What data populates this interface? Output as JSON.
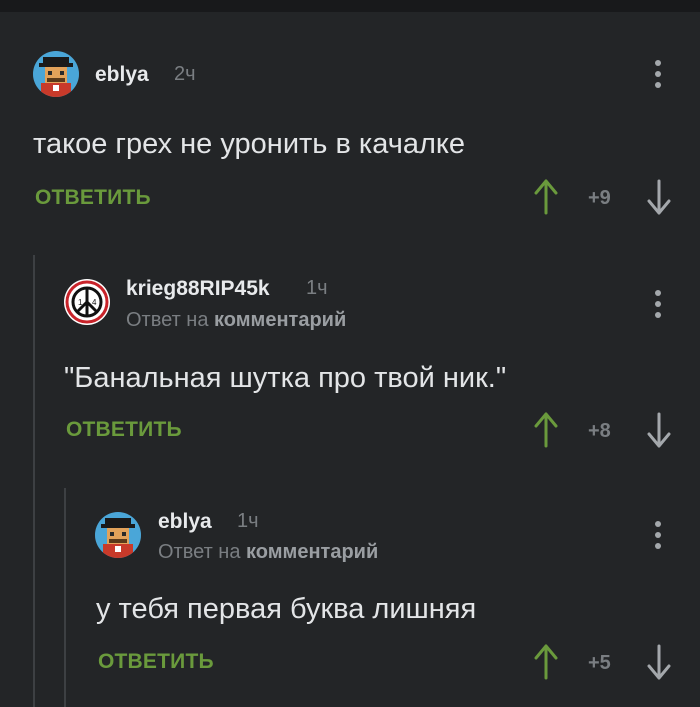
{
  "comments": [
    {
      "username": "eblya",
      "time": "2ч",
      "reply_prefix": "",
      "reply_link": "",
      "text": "такое грех не уронить в качалке",
      "reply_label": "ОТВЕТИТЬ",
      "score": "+9",
      "avatar_icon": "pixel-character-avatar"
    },
    {
      "username": "krieg88RIP45k",
      "time": "1ч",
      "reply_prefix": "Ответ на ",
      "reply_link": "комментарий",
      "text": "\"Банальная шутка про твой ник.\"",
      "reply_label": "ОТВЕТИТЬ",
      "score": "+8",
      "avatar_icon": "peace-sign-avatar"
    },
    {
      "username": "eblya",
      "time": "1ч",
      "reply_prefix": "Ответ на ",
      "reply_link": "комментарий",
      "text": "у тебя первая буква лишняя",
      "reply_label": "ОТВЕТИТЬ",
      "score": "+5",
      "avatar_icon": "pixel-character-avatar"
    }
  ],
  "colors": {
    "background": "#232527",
    "accent_green": "#6a9a3c",
    "muted": "#7a7e82"
  }
}
